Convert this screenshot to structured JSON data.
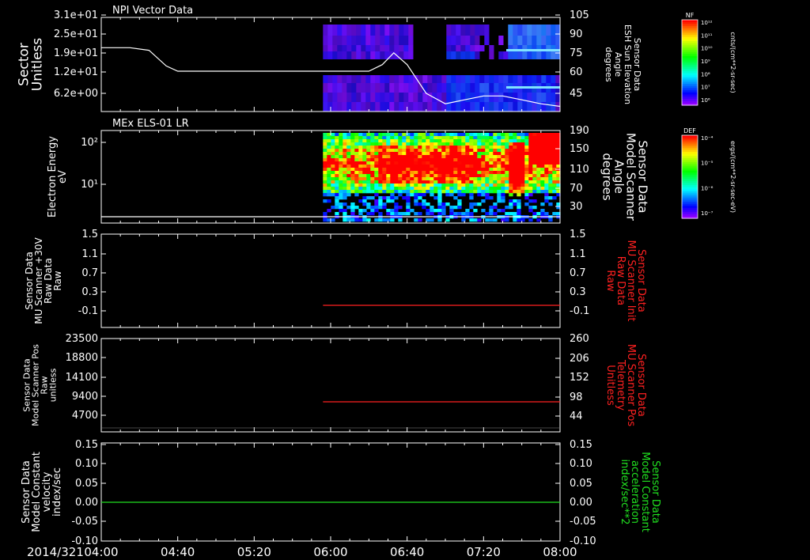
{
  "chart_data": [
    {
      "type": "heatmap",
      "title": "NPI Vector Data",
      "ylabel": [
        "Sector",
        "Unitless"
      ],
      "y_ticks": [
        "3.1e+01",
        "2.5e+01",
        "1.9e+01",
        "1.2e+01",
        "6.2e+00"
      ],
      "right_ylabel": [
        "Sensor Data",
        "ESH Sun Elevation",
        "Angle",
        "degrees"
      ],
      "right_ticks": [
        "105",
        "90",
        "75",
        "60",
        "45"
      ],
      "right_range": [
        30,
        105
      ],
      "line_series": {
        "color": "#ffffff",
        "x": [
          "04:00",
          "04:15",
          "04:25",
          "04:34",
          "04:40",
          "05:00",
          "05:30",
          "06:00",
          "06:20",
          "06:27",
          "06:33",
          "06:40",
          "06:50",
          "07:00",
          "07:10",
          "07:20",
          "07:30",
          "07:40",
          "07:50",
          "08:00"
        ],
        "y": [
          80,
          80,
          78,
          66,
          62,
          62,
          62,
          62,
          62,
          67,
          76,
          67,
          45,
          37,
          40,
          43,
          43,
          40,
          37,
          35
        ]
      },
      "colorbar": {
        "label": "NF",
        "units": "cnts/(cm**2-sr-sec)",
        "ticks": [
          "10¹²",
          "10¹¹",
          "10¹⁰",
          "10⁹",
          "10⁸",
          "10⁷",
          "10⁶"
        ]
      }
    },
    {
      "type": "heatmap",
      "title": "MEx ELS-01 LR",
      "ylabel": [
        "Electron Energy",
        "eV"
      ],
      "y_ticks": [
        "10²",
        "10¹"
      ],
      "right_ylabel": [
        "Sensor Data",
        "Model Scanner",
        "Angle",
        "degrees"
      ],
      "right_ticks": [
        "190",
        "150",
        "110",
        "70",
        "30"
      ],
      "right_range": [
        0,
        190
      ],
      "line_series": {
        "color": "#ffffff",
        "x": [
          "04:00",
          "08:00"
        ],
        "y": [
          10,
          10
        ]
      },
      "colorbar": {
        "label": "DEF",
        "units": "ergs/(cm**2-sr-sec-eV)",
        "ticks": [
          "10⁻⁴",
          "10⁻⁵",
          "10⁻⁶",
          "10⁻⁷"
        ]
      }
    },
    {
      "type": "line",
      "ylabel": [
        "Sensor Data",
        "MU Scanner +30V",
        "Raw Data",
        "Raw"
      ],
      "y_ticks": [
        "1.5",
        "1.1",
        "0.7",
        "0.3",
        "-0.1"
      ],
      "right_ylabel": [
        "Sensor Data",
        "MU Scanner Init",
        "Raw Data",
        "Raw"
      ],
      "right_ticks": [
        "1.5",
        "1.1",
        "0.7",
        "0.3",
        "-0.1"
      ],
      "ylim": [
        -0.5,
        1.5
      ],
      "series": [
        {
          "color": "#ff2020",
          "x": [
            "05:56",
            "08:00"
          ],
          "y": [
            -0.01,
            -0.01
          ]
        }
      ]
    },
    {
      "type": "line",
      "ylabel": [
        "Sensor Data",
        "Model Scanner Pos",
        "Raw",
        "unitless"
      ],
      "y_ticks": [
        "23500",
        "18800",
        "14100",
        "9400",
        "4700"
      ],
      "right_ylabel": [
        "Sensor Data",
        "MU Scanner Pos",
        "Telemetry",
        "Unitless"
      ],
      "right_ticks": [
        "260",
        "206",
        "152",
        "98",
        "44"
      ],
      "ylim": [
        0,
        23500
      ],
      "series": [
        {
          "color": "#ff2020",
          "x": [
            "05:56",
            "08:00"
          ],
          "y": [
            8150,
            8150
          ]
        }
      ]
    },
    {
      "type": "line",
      "ylabel": [
        "Sensor Data",
        "Model Constant",
        "velocity",
        "index/sec"
      ],
      "y_ticks": [
        "0.15",
        "0.10",
        "0.05",
        "0.00",
        "-0.05",
        "-0.10"
      ],
      "right_ylabel": [
        "Sensor Data",
        "Model Constant",
        "acceleration",
        "index/sec**2"
      ],
      "right_ticks": [
        "0.15",
        "0.10",
        "0.05",
        "0.00",
        "-0.05",
        "-0.10"
      ],
      "ylim": [
        -0.1,
        0.15
      ],
      "series": [
        {
          "color": "#20e020",
          "x": [
            "04:00",
            "08:00"
          ],
          "y": [
            0.0,
            0.0
          ]
        }
      ]
    }
  ],
  "x_axis": {
    "date_label": "2014/321",
    "ticks": [
      "04:00",
      "04:40",
      "05:20",
      "06:00",
      "06:40",
      "07:20",
      "08:00"
    ]
  }
}
